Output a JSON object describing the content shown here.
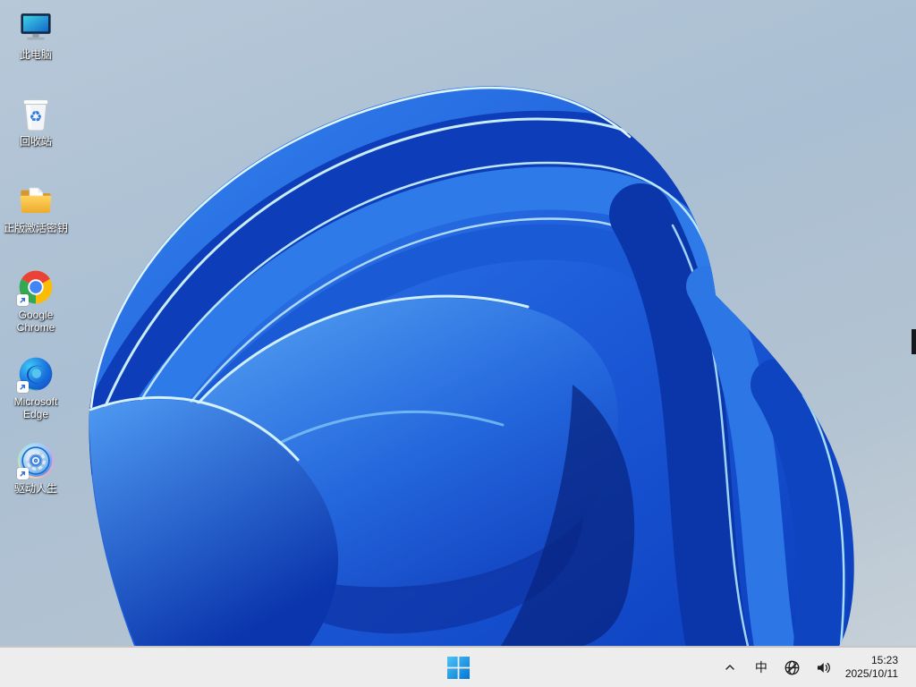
{
  "desktop": {
    "icons": [
      {
        "id": "this-pc",
        "label": "此电脑"
      },
      {
        "id": "recycle-bin",
        "label": "回收站"
      },
      {
        "id": "activation-key-folder",
        "label": "正版激活密钥"
      },
      {
        "id": "google-chrome",
        "label": "Google Chrome"
      },
      {
        "id": "microsoft-edge",
        "label": "Microsoft Edge"
      },
      {
        "id": "driver-life",
        "label": "驱动人生"
      }
    ],
    "recycle_glyph": "♻"
  },
  "taskbar": {
    "tray": {
      "ime": "中",
      "time": "15:23",
      "date": "2025/10/11"
    }
  },
  "colors": {
    "taskbar_bg": "#ededed",
    "taskbar_border": "#c6c6c6",
    "wallpaper_bg_top": "#b7c8d8",
    "wallpaper_bg_bottom": "#c9d2d9",
    "bloom_deep_blue": "#0b3dbc",
    "bloom_mid_blue": "#2f7de9",
    "bloom_light_blue": "#5aa7f4",
    "bloom_edge_highlight": "#cfeffc",
    "start_logo_gradient_top": "#4cc4f5",
    "start_logo_gradient_bottom": "#0575d4",
    "tray_icon_color": "#1f1f1f"
  }
}
